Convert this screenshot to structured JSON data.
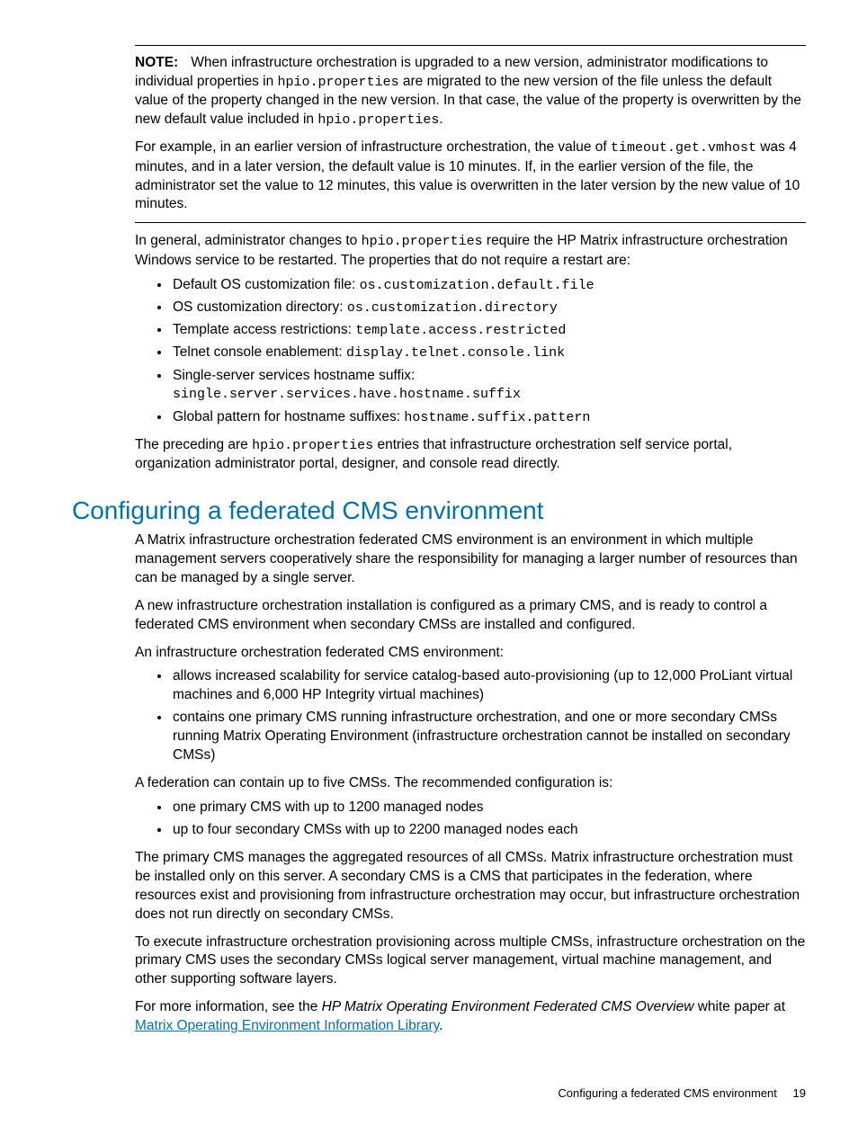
{
  "note": {
    "label": "NOTE:",
    "p1a": "When infrastructure orchestration is upgraded to a new version, administrator modifications to individual properties in ",
    "p1code1": "hpio.properties",
    "p1b": " are migrated to the new version of the file unless the default value of the property changed in the new version. In that case, the value of the property is overwritten by the new default value included in ",
    "p1code2": "hpio.properties",
    "p1c": ".",
    "p2a": "For example, in an earlier version of infrastructure orchestration, the value of ",
    "p2code": "timeout.get.vmhost",
    "p2b": " was 4 minutes, and in a later version, the default value is 10 minutes. If, in the earlier version of the file, the administrator set the value to 12 minutes, this value is overwritten in the later version by the new value of 10 minutes."
  },
  "general": {
    "p1a": "In general, administrator changes to ",
    "p1code": "hpio.properties",
    "p1b": " require the HP Matrix infrastructure orchestration Windows service to be restarted. The properties that do not require a restart are:",
    "items": [
      {
        "label": "Default OS customization file: ",
        "code": "os.customization.default.file"
      },
      {
        "label": "OS customization directory: ",
        "code": "os.customization.directory"
      },
      {
        "label": "Template access restrictions: ",
        "code": "template.access.restricted"
      },
      {
        "label": "Telnet console enablement: ",
        "code": "display.telnet.console.link"
      },
      {
        "label": "Single-server services hostname suffix: ",
        "code": "single.server.services.have.hostname.suffix"
      },
      {
        "label": "Global pattern for hostname suffixes: ",
        "code": "hostname.suffix.pattern"
      }
    ],
    "p2a": "The preceding are ",
    "p2code": "hpio.properties",
    "p2b": " entries that infrastructure orchestration self service portal, organization administrator portal, designer, and console read directly."
  },
  "section": {
    "heading": "Configuring a federated CMS environment",
    "p1": "A Matrix infrastructure orchestration federated CMS environment is an environment in which multiple management servers cooperatively share the responsibility for managing a larger number of resources than can be managed by a single server.",
    "p2": "A new infrastructure orchestration installation is configured as a primary CMS, and is ready to control a federated CMS environment when secondary CMSs are installed and configured.",
    "p3": "An infrastructure orchestration federated CMS environment:",
    "list1": [
      "allows increased scalability for service catalog-based auto-provisioning (up to 12,000 ProLiant virtual machines and 6,000 HP Integrity virtual machines)",
      "contains one primary CMS running infrastructure orchestration, and one or more secondary CMSs running Matrix Operating Environment (infrastructure orchestration cannot be installed on secondary CMSs)"
    ],
    "p4": "A federation can contain up to five CMSs. The recommended configuration is:",
    "list2": [
      "one primary CMS with up to 1200 managed nodes",
      "up to four secondary CMSs with up to 2200 managed nodes each"
    ],
    "p5": "The primary CMS manages the aggregated resources of all CMSs. Matrix infrastructure orchestration must be installed only on this server. A secondary CMS is a CMS that participates in the federation, where resources exist and provisioning from infrastructure orchestration may occur, but infrastructure orchestration does not run directly on secondary CMSs.",
    "p6": "To execute infrastructure orchestration provisioning across multiple CMSs, infrastructure orchestration on the primary CMS uses the secondary CMSs logical server management, virtual machine management, and other supporting software layers.",
    "p7a": "For more information, see the ",
    "p7italic": "HP Matrix Operating Environment Federated CMS Overview",
    "p7b": " white paper at ",
    "p7link": "Matrix Operating Environment Information Library",
    "p7c": "."
  },
  "footer": {
    "title": "Configuring a federated CMS environment",
    "page": "19"
  }
}
